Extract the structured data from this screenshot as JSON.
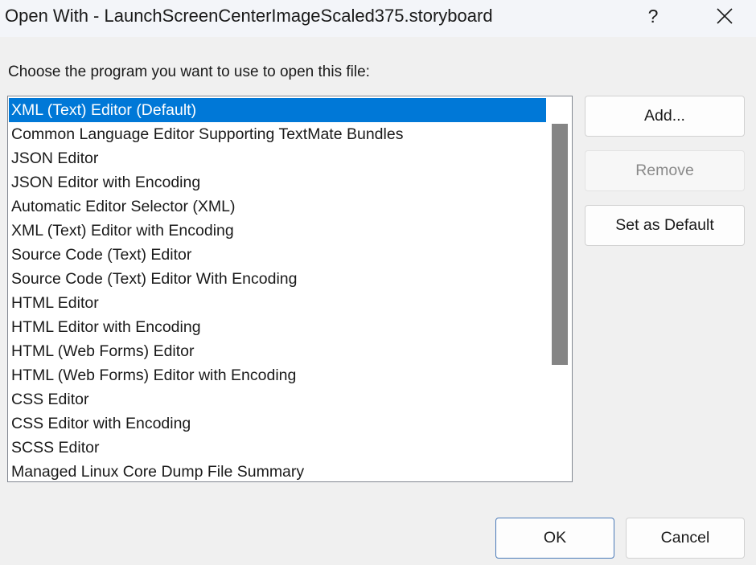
{
  "window": {
    "title": "Open With - LaunchScreenCenterImageScaled375.storyboard",
    "help_label": "?",
    "close_icon": "close-icon"
  },
  "prompt": "Choose the program you want to use to open this file:",
  "programs": [
    "XML (Text) Editor (Default)",
    "Common Language Editor Supporting TextMate Bundles",
    "JSON Editor",
    "JSON Editor with Encoding",
    "Automatic Editor Selector (XML)",
    "XML (Text) Editor with Encoding",
    "Source Code (Text) Editor",
    "Source Code (Text) Editor With Encoding",
    "HTML Editor",
    "HTML Editor with Encoding",
    "HTML (Web Forms) Editor",
    "HTML (Web Forms) Editor with Encoding",
    "CSS Editor",
    "CSS Editor with Encoding",
    "SCSS Editor",
    "Managed Linux Core Dump File Summary"
  ],
  "selected_program": "XML (Text) Editor (Default)",
  "buttons": {
    "add": "Add...",
    "remove": "Remove",
    "set_default": "Set as Default",
    "ok": "OK",
    "cancel": "Cancel"
  },
  "colors": {
    "selection": "#0078d7",
    "background": "#f0f0f0"
  }
}
